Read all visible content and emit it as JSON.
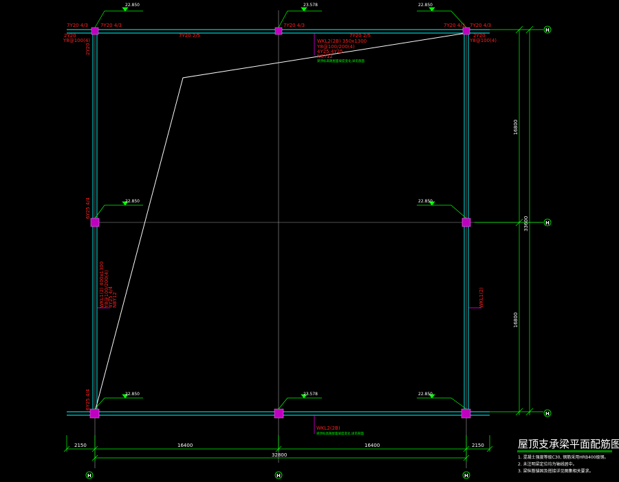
{
  "drawing": {
    "title": "屋顶支承梁平面配筋图",
    "notes": [
      "1. 混凝土强度等级C30, 钢筋采用HRB400级钢。",
      "2. 未注明梁定位均为轴线居中。",
      "3. 梁纵筋锚固及搭接详见图集相关要求。"
    ],
    "dimensions": {
      "bottom_segments": [
        "2150",
        "16400",
        "16400",
        "2150"
      ],
      "bottom_total": "32800",
      "right_segments": [
        "16800",
        "16800"
      ],
      "right_total": "33600"
    },
    "elevations": {
      "top_left": "22.850",
      "top_mid": "23.578",
      "top_right": "22.850",
      "mid_left": "22.850",
      "mid_right": "22.850",
      "bot_left": "22.850",
      "bot_mid": "23.578",
      "bot_right": "22.850"
    },
    "beam_labels": {
      "top_left_a": "7Y20 4/3",
      "top_left_b": "7Y20 4/3",
      "top_left_c": "2Y20",
      "top_left_d": "Y8@100(4)",
      "top_mid_a": "7Y20 2/5",
      "top_mid_b": "7Y20 4/3",
      "top_right_mid": "7Y20 2/5",
      "top_right_a": "7Y20 4/3",
      "top_right_b": "7Y20 4/3",
      "top_right_c": "2Y20",
      "top_right_d": "Y8@100(4)",
      "wkl2_name": "WKL2(2B) 350x1300",
      "wkl2_a": "Y8@100/200(4)",
      "wkl2_b": "4Y25;4Y25",
      "wkl2_c": "N8Y12",
      "wkl2_note": "梁顶标高随屋面坡度变化,详见剖面",
      "left_upper": "6Y25 4/4",
      "wkl1_name": "WKL1(2) 400x1300",
      "wkl1_a": "Y8@100/200(4)",
      "wkl1_b": "4Y25 4/4",
      "wkl1_c": "N8Y12",
      "left_lower": "6Y25 4/4",
      "right_wkl1": "WKL1(2)",
      "bot_wkl2": "WKL2(2B)",
      "bot_wkl2_note": "梁顶标高随屋面坡度变化,详见剖面"
    },
    "axis_labels": {
      "right_top": "H",
      "right_mid": "H",
      "right_bot": "H",
      "bot_left": "H",
      "bot_mid": "H",
      "bot_right": "H"
    },
    "colors": {
      "beam": "#00ffff",
      "grid": "#c0c0c0",
      "column": "#c000c0",
      "dim": "#00ff00",
      "text_red": "#ff2020",
      "text_green": "#00ff00",
      "leader": "#00ff00",
      "slope": "#ffffff"
    }
  }
}
